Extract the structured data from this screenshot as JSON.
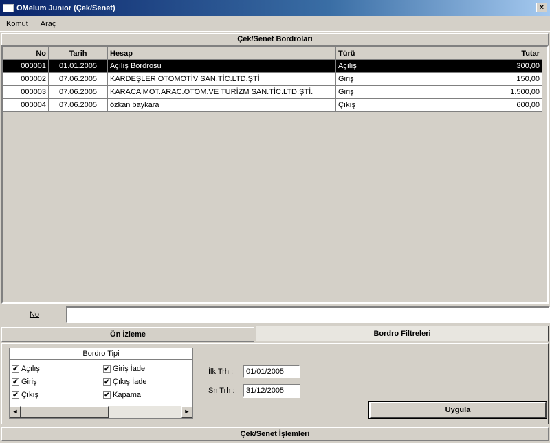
{
  "window": {
    "title": "OMelum Junior (Çek/Senet)",
    "close": "×"
  },
  "menu": [
    {
      "label": "Komut"
    },
    {
      "label": "Araç"
    }
  ],
  "grid": {
    "header": "Çek/Senet Bordroları",
    "columns": [
      {
        "label": "No"
      },
      {
        "label": "Tarih"
      },
      {
        "label": "Hesap"
      },
      {
        "label": "Türü"
      },
      {
        "label": "Tutar"
      }
    ],
    "rows": [
      {
        "no": "000001",
        "tarih": "01.01.2005",
        "hesap": "Açılış Bordrosu",
        "turu": "Açılış",
        "tutar": "300,00"
      },
      {
        "no": "000002",
        "tarih": "07.06.2005",
        "hesap": "KARDEŞLER OTOMOTİV SAN.TİC.LTD.ŞTİ",
        "turu": "Giriş",
        "tutar": "150,00"
      },
      {
        "no": "000003",
        "tarih": "07.06.2005",
        "hesap": "KARACA MOT.ARAC.OTOM.VE TURİZM SAN.TİC.LTD.ŞTİ.",
        "turu": "Giriş",
        "tutar": "1.500,00"
      },
      {
        "no": "000004",
        "tarih": "07.06.2005",
        "hesap": "özkan baykara",
        "turu": "Çıkış",
        "tutar": "600,00"
      }
    ]
  },
  "no_field": {
    "label": "No",
    "value": ""
  },
  "tabs": [
    {
      "label": "Ön İzleme"
    },
    {
      "label": "Bordro Filtreleri"
    }
  ],
  "bordro_tipi": {
    "title": "Bordro Tipi",
    "items": [
      {
        "label": "Açılış",
        "checked": true
      },
      {
        "label": "Giriş",
        "checked": true
      },
      {
        "label": "Çıkış",
        "checked": true
      },
      {
        "label": "Giriş İade",
        "checked": true
      },
      {
        "label": "Çıkış İade",
        "checked": true
      },
      {
        "label": "Kapama",
        "checked": true
      }
    ],
    "scroll_left": "◄",
    "scroll_right": "►"
  },
  "filters": {
    "ilk_label": "İlk Trh :",
    "ilk_value": "01/01/2005",
    "son_label": "Sn Trh :",
    "son_value": "31/12/2005"
  },
  "apply_button": "Uygula",
  "footer": "Çek/Senet İşlemleri",
  "check_mark": "✔"
}
